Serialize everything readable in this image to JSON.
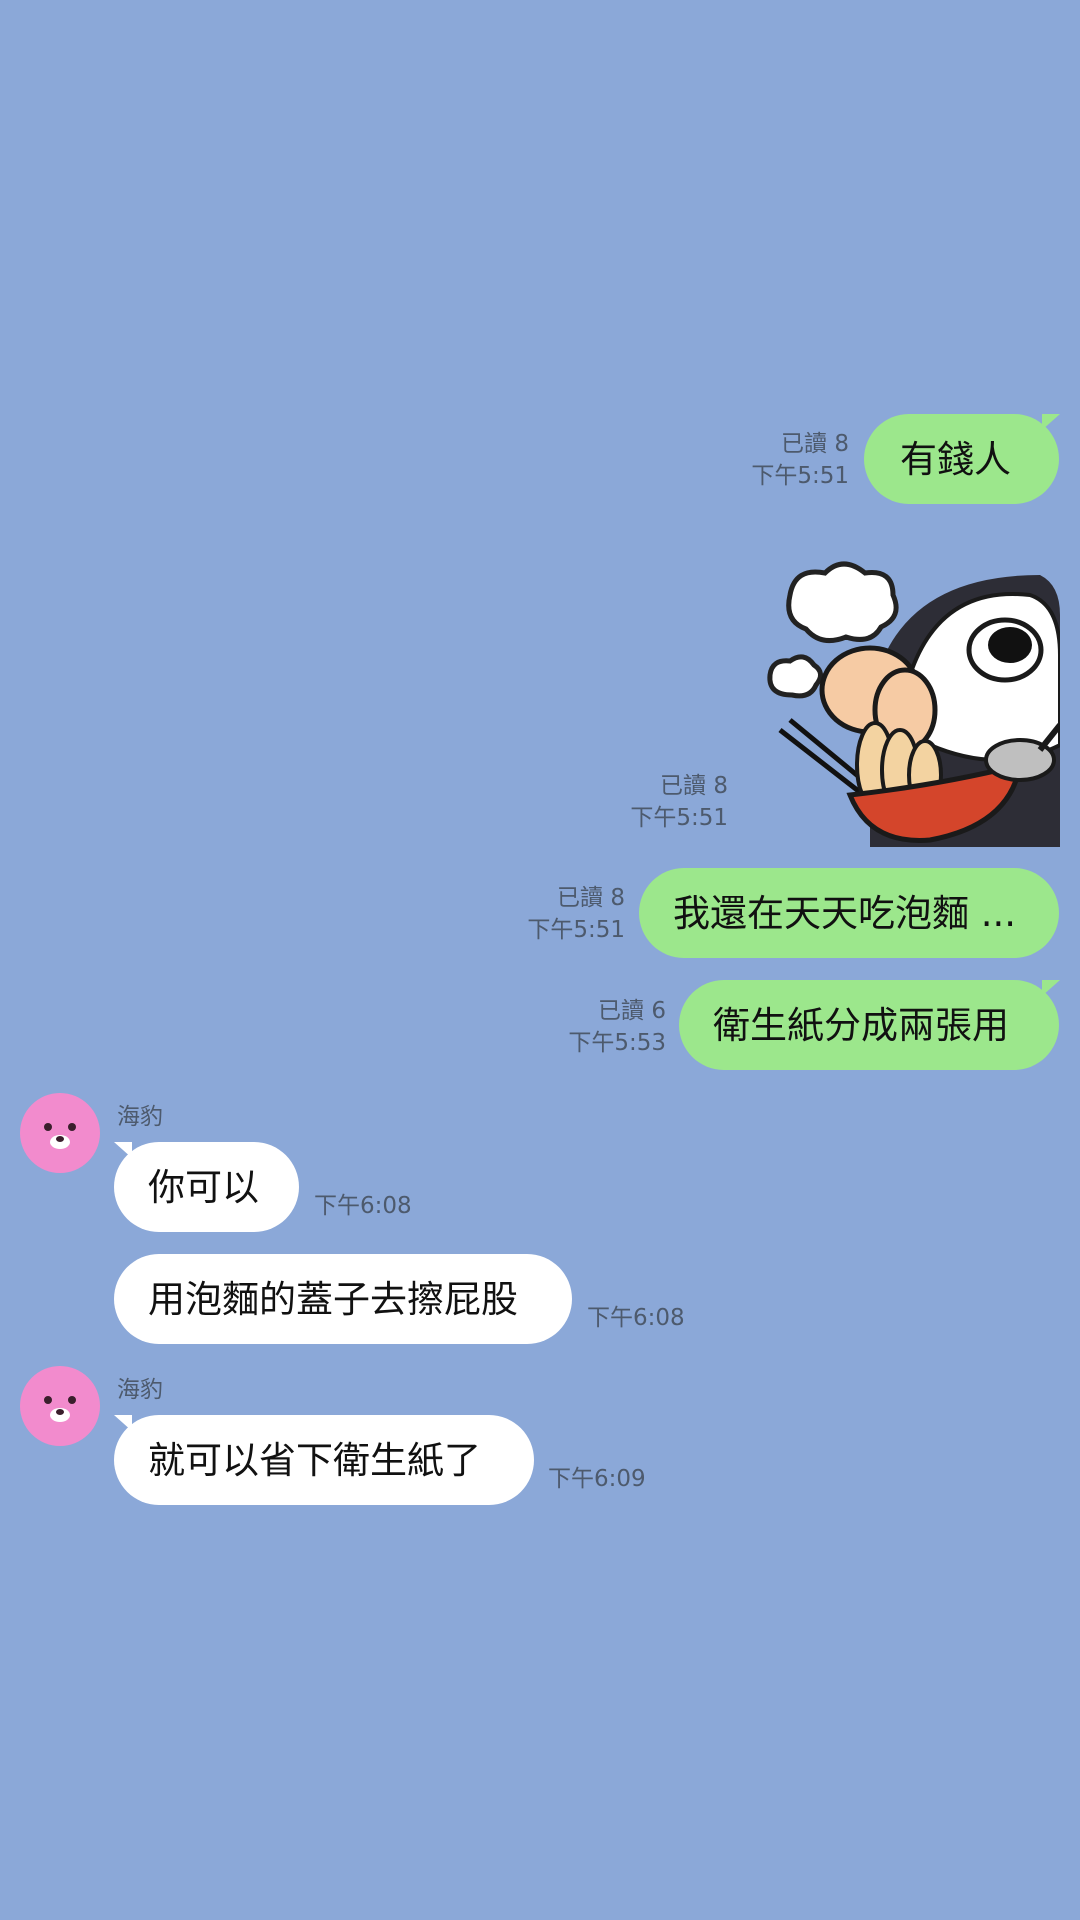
{
  "chat": {
    "messages_out": [
      {
        "text": "有錢人",
        "read": "已讀 8",
        "time": "下午5:51"
      },
      {
        "sticker": "penguin-eating-noodles-sticker",
        "read": "已讀 8",
        "time": "下午5:51"
      },
      {
        "text": "我還在天天吃泡麵 ...",
        "read": "已讀 8",
        "time": "下午5:51"
      },
      {
        "text": "衛生紙分成兩張用",
        "read": "已讀 6",
        "time": "下午5:53"
      }
    ],
    "messages_in": [
      {
        "sender": "海豹",
        "text": "你可以",
        "time": "下午6:08"
      },
      {
        "text": "用泡麵的蓋子去擦屁股",
        "time": "下午6:08"
      },
      {
        "sender": "海豹",
        "text": "就可以省下衛生紙了",
        "time": "下午6:09"
      }
    ]
  },
  "colors": {
    "background": "#8ba8d8",
    "outgoing_bubble": "#9ce78c",
    "incoming_bubble": "#ffffff",
    "avatar": "#f28bcd"
  }
}
